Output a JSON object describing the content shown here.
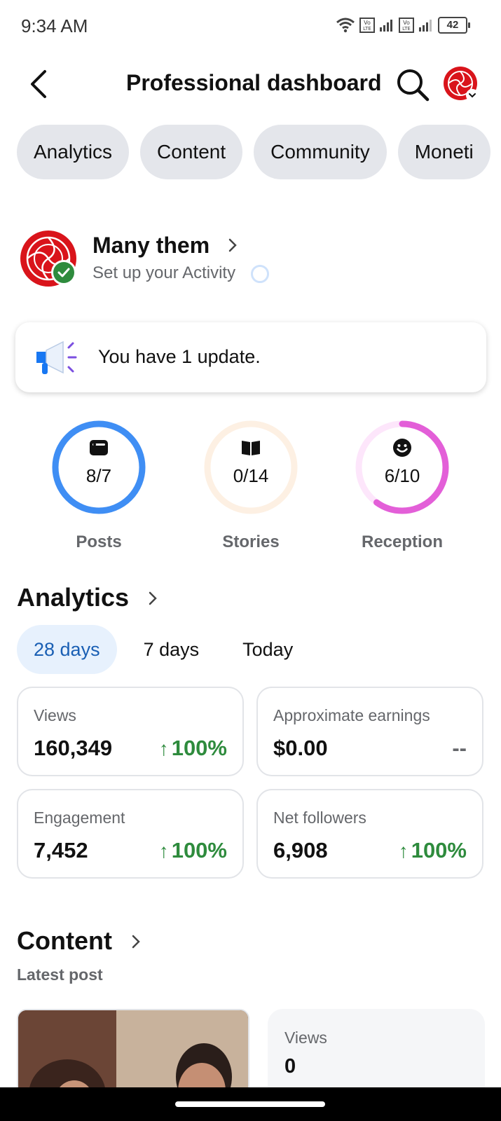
{
  "status_bar": {
    "time": "9:34 AM",
    "battery": "42"
  },
  "header": {
    "title": "Professional dashboard"
  },
  "tabs": [
    {
      "label": "Analytics"
    },
    {
      "label": "Content"
    },
    {
      "label": "Community"
    },
    {
      "label": "Moneti"
    }
  ],
  "profile": {
    "name": "Many them",
    "subtitle": "Set up your Activity"
  },
  "update": {
    "text": "You have 1 update."
  },
  "goals": [
    {
      "label": "Posts",
      "value": "8/7",
      "icon": "post-card-icon",
      "progress": 1.0,
      "color": "#3f8ef4"
    },
    {
      "label": "Stories",
      "value": "0/14",
      "icon": "book-icon",
      "progress": 0.0,
      "color": "#f7c894"
    },
    {
      "label": "Reception",
      "value": "6/10",
      "icon": "smiley-icon",
      "progress": 0.6,
      "color": "#e35fd8"
    }
  ],
  "analytics": {
    "title": "Analytics",
    "ranges": [
      {
        "label": "28 days",
        "active": true
      },
      {
        "label": "7 days",
        "active": false
      },
      {
        "label": "Today",
        "active": false
      }
    ],
    "stats": [
      {
        "label": "Views",
        "value": "160,349",
        "delta": "100%",
        "arrow": "↑"
      },
      {
        "label": "Approximate earnings",
        "value": "$0.00",
        "delta": "--",
        "arrow": ""
      },
      {
        "label": "Engagement",
        "value": "7,452",
        "delta": "100%",
        "arrow": "↑"
      },
      {
        "label": "Net followers",
        "value": "6,908",
        "delta": "100%",
        "arrow": "↑"
      }
    ]
  },
  "content": {
    "title": "Content",
    "latest_label": "Latest post",
    "views_label": "Views",
    "views_value": "0"
  },
  "colors": {
    "accent_blue": "#1a5fb4",
    "positive_green": "#2e8b3d",
    "pill_bg": "#e4e6eb"
  }
}
